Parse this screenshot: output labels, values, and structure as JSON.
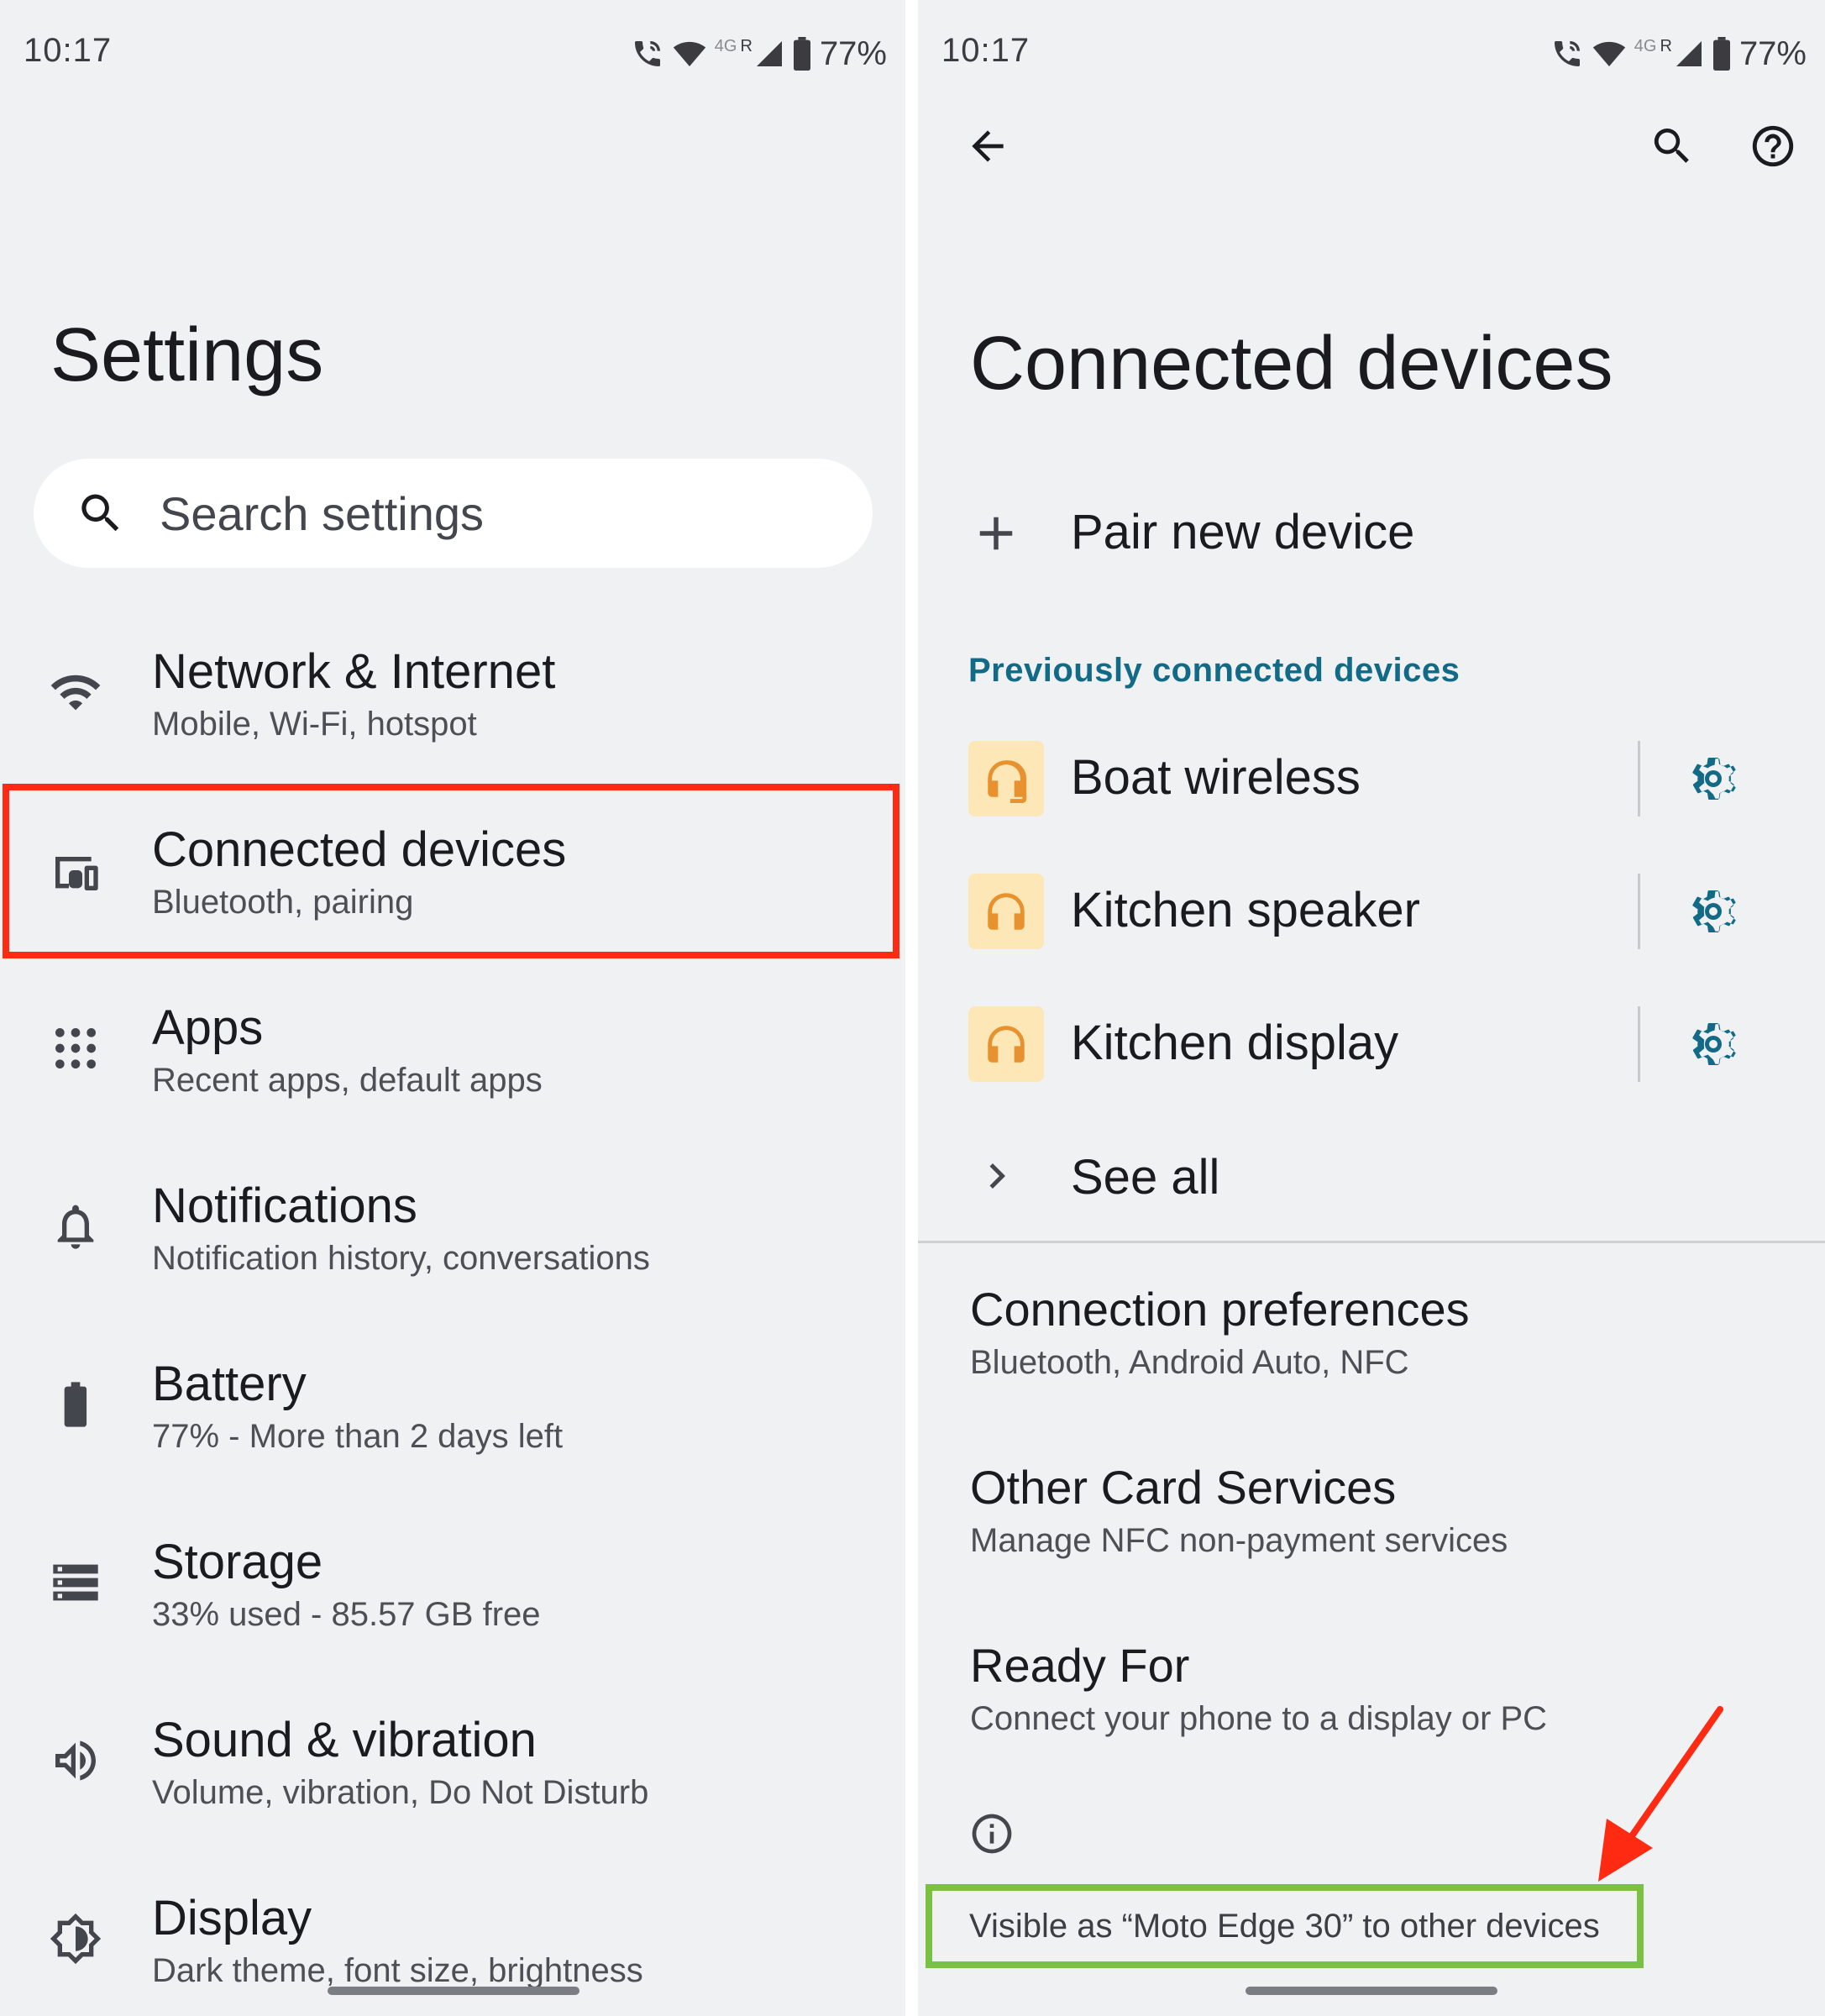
{
  "left": {
    "status": {
      "time": "10:17",
      "network": "4G",
      "roaming": "R",
      "battery": "77%"
    },
    "title": "Settings",
    "search": {
      "placeholder": "Search settings"
    },
    "items": [
      {
        "title": "Network & Internet",
        "subtitle": "Mobile, Wi-Fi, hotspot",
        "icon": "wifi-icon"
      },
      {
        "title": "Connected devices",
        "subtitle": "Bluetooth, pairing",
        "icon": "connected-devices-icon"
      },
      {
        "title": "Apps",
        "subtitle": "Recent apps, default apps",
        "icon": "apps-grid-icon"
      },
      {
        "title": "Notifications",
        "subtitle": "Notification history, conversations",
        "icon": "bell-icon"
      },
      {
        "title": "Battery",
        "subtitle": "77% - More than 2 days left",
        "icon": "battery-icon"
      },
      {
        "title": "Storage",
        "subtitle": "33% used - 85.57 GB free",
        "icon": "storage-icon"
      },
      {
        "title": "Sound & vibration",
        "subtitle": "Volume, vibration, Do Not Disturb",
        "icon": "speaker-icon"
      },
      {
        "title": "Display",
        "subtitle": "Dark theme, font size, brightness",
        "icon": "brightness-icon"
      }
    ],
    "highlight_color": "#ff2a12"
  },
  "right": {
    "status": {
      "time": "10:17",
      "network": "4G",
      "roaming": "R",
      "battery": "77%"
    },
    "title": "Connected devices",
    "pair_new": "Pair new device",
    "section_header": "Previously connected devices",
    "devices": [
      {
        "name": "Boat wireless",
        "icon": "headphones-icon"
      },
      {
        "name": "Kitchen speaker",
        "icon": "headphones-icon"
      },
      {
        "name": "Kitchen display",
        "icon": "headphones-icon"
      }
    ],
    "see_all": "See all",
    "prefs": [
      {
        "title": "Connection preferences",
        "subtitle": "Bluetooth, Android Auto, NFC"
      },
      {
        "title": "Other Card Services",
        "subtitle": "Manage NFC non-payment services"
      },
      {
        "title": "Ready For",
        "subtitle": "Connect your phone to a display or PC"
      }
    ],
    "visible_as": "Visible as “Moto Edge 30” to other devices",
    "accent_color": "#136a86",
    "avatar_color": "#fde7b6",
    "highlight_color": "#7ac143",
    "arrow_color": "#ff2a12"
  }
}
